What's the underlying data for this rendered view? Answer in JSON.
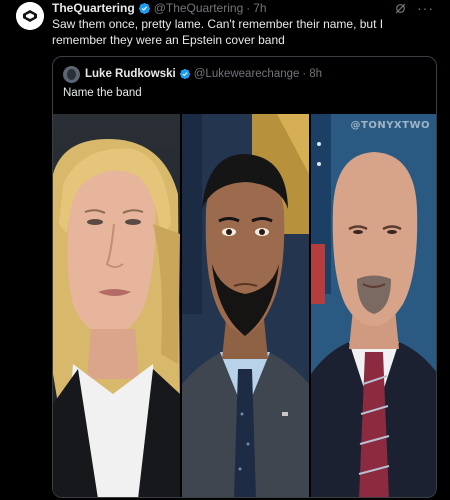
{
  "post": {
    "author_name": "TheQuartering",
    "author_handle": "@TheQuartering",
    "separator": "·",
    "time": "7h",
    "text": "Saw them once, pretty lame.  Can't remember their name, but I remember they were an Epstein cover band",
    "more_label": "···"
  },
  "quote": {
    "author_name": "Luke Rudkowski",
    "author_handle": "@Lukewearechange",
    "separator": "·",
    "time": "8h",
    "text": "Name the band"
  },
  "photo": {
    "watermark": "@TONYXTWO",
    "panels": [
      {
        "subject": "woman-blonde-hair-black-jacket"
      },
      {
        "subject": "man-dark-hair-beard-navy-suit"
      },
      {
        "subject": "man-bald-goatee-dark-suit-red-tie"
      }
    ]
  },
  "colors": {
    "background": "#000000",
    "text": "#e7e9ea",
    "muted": "#71767b",
    "verified": "#1d9bf0",
    "border": "#3a3f44"
  },
  "icons": {
    "avatar": "quartering-logo",
    "verified": "verified-badge-icon",
    "grok": "grok-icon",
    "more": "more-icon"
  }
}
